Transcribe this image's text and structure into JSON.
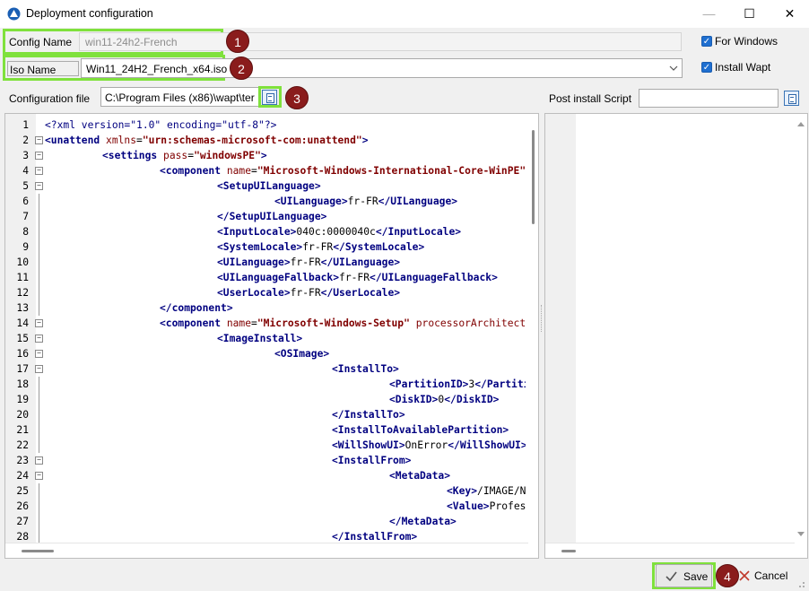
{
  "window": {
    "title": "Deployment configuration",
    "minimize": "—",
    "maximize": "☐",
    "close": "✕"
  },
  "form": {
    "config_name_label": "Config Name",
    "config_name_value": "win11-24h2-French",
    "iso_name_label": "Iso Name",
    "iso_name_value": "Win11_24H2_French_x64.iso",
    "config_file_label": "Configuration file",
    "config_file_value": "C:\\Program Files (x86)\\wapt\\ter",
    "post_install_label": "Post install Script",
    "post_install_value": ""
  },
  "options": {
    "for_windows": "For Windows",
    "install_wapt": "Install Wapt"
  },
  "badges": [
    "1",
    "2",
    "3",
    "4"
  ],
  "editor": {
    "line_numbers": [
      "1",
      "2",
      "3",
      "4",
      "5",
      "6",
      "7",
      "8",
      "9",
      "10",
      "11",
      "12",
      "13",
      "14",
      "15",
      "16",
      "17",
      "18",
      "19",
      "20",
      "21",
      "22",
      "23",
      "24",
      "25",
      "26",
      "27",
      "28"
    ]
  },
  "buttons": {
    "save": "Save",
    "cancel": "Cancel"
  },
  "colors": {
    "highlight": "#7fe13c",
    "badge": "#8a1c1c",
    "xml_tag": "#000080",
    "xml_attr": "#800000"
  }
}
